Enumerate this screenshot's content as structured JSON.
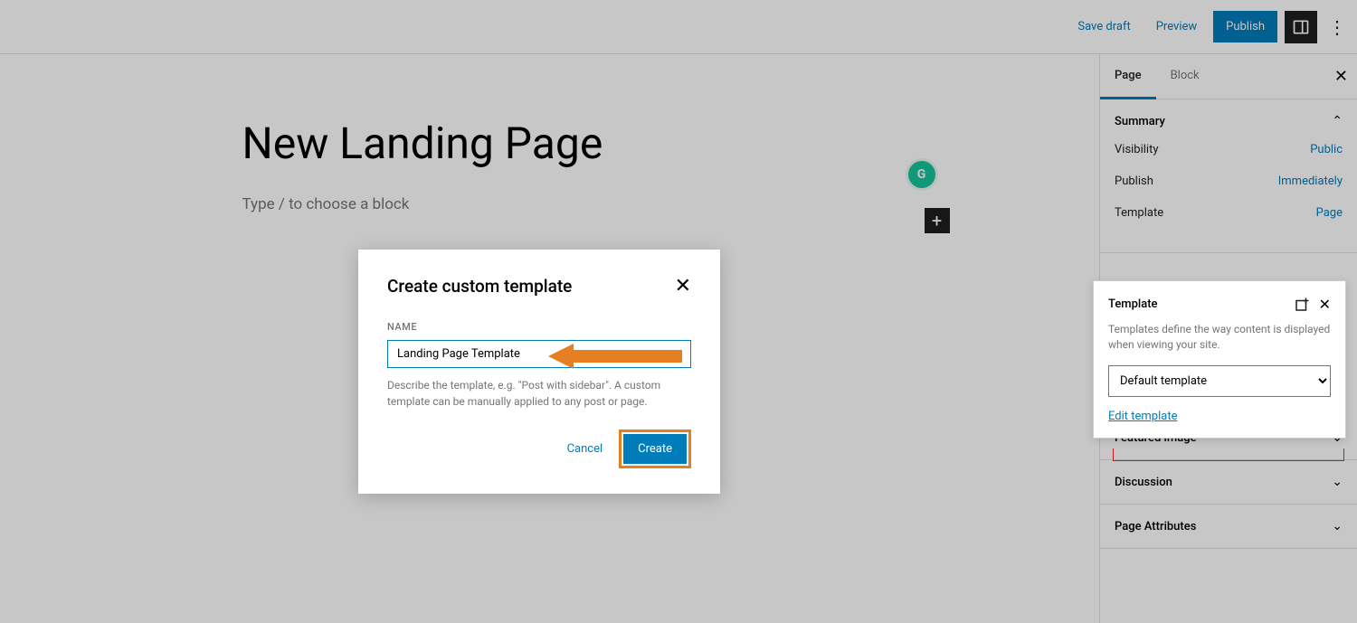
{
  "topbar": {
    "save_draft": "Save draft",
    "preview": "Preview",
    "publish": "Publish"
  },
  "canvas": {
    "title": "New Landing Page",
    "placeholder": "Type / to choose a block",
    "grammarly_badge": "G"
  },
  "sidebar": {
    "tabs": {
      "page": "Page",
      "block": "Block"
    },
    "summary": {
      "heading": "Summary",
      "visibility_label": "Visibility",
      "visibility_value": "Public",
      "publish_label": "Publish",
      "publish_value": "Immediately",
      "template_label": "Template",
      "template_value": "Page"
    },
    "sections": {
      "featured_image": "Featured image",
      "discussion": "Discussion",
      "page_attributes": "Page Attributes"
    }
  },
  "template_popover": {
    "title": "Template",
    "description": "Templates define the way content is displayed when viewing your site.",
    "selected": "Default template",
    "edit_link": "Edit template"
  },
  "modal": {
    "title": "Create custom template",
    "name_label": "NAME",
    "name_value": "Landing Page Template",
    "help_text": "Describe the template, e.g. \"Post with sidebar\". A custom template can be manually applied to any post or page.",
    "cancel": "Cancel",
    "create": "Create"
  }
}
